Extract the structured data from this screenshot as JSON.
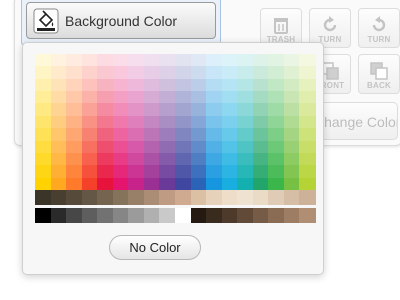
{
  "toolbar": {
    "background_color_label": "Background Color",
    "buttons": [
      {
        "label": "TRASH",
        "icon": "trash-icon"
      },
      {
        "label": "TURN",
        "icon": "rotate-cw-icon"
      },
      {
        "label": "TURN",
        "icon": "rotate-ccw-icon"
      },
      {
        "label": "FRONT",
        "icon": "bring-front-icon"
      },
      {
        "label": "BACK",
        "icon": "send-back-icon"
      }
    ],
    "change_color_label": "Change Color"
  },
  "color_popup": {
    "no_color_label": "No Color",
    "hue_columns": [
      "#ffd200",
      "#ffa820",
      "#ff7a2a",
      "#f5412a",
      "#e8133d",
      "#e4146f",
      "#c8228b",
      "#9a2f94",
      "#6a3a98",
      "#3f47a0",
      "#2b64b7",
      "#1696de",
      "#18aee0",
      "#14b0b0",
      "#21a56a",
      "#3ab64a",
      "#76c043",
      "#b5d335"
    ],
    "shade_rows": 11,
    "neutral_row": [
      "#3b3428",
      "#483f31",
      "#564b3a",
      "#655745",
      "#756550",
      "#86735c",
      "#987f68",
      "#ab8d75",
      "#be9b82",
      "#cfaa90",
      "#dcc0a4",
      "#e6d2bb",
      "#edddc9",
      "#f0e2d0",
      "#eadbc7",
      "#e0ccb6",
      "#d6bea6",
      "#cdb198"
    ],
    "gray_row": [
      "#000000",
      "#2a2a2a",
      "#474747",
      "#5e5e5e",
      "#727272",
      "#868686",
      "#9b9b9b",
      "#b0b0b0",
      "#c9c9c9",
      "#ffffff",
      "#241a12",
      "#3a2b1f",
      "#4d3a2b",
      "#614a38",
      "#765b46",
      "#8a6c55",
      "#9d7d64",
      "#b08e74"
    ]
  }
}
